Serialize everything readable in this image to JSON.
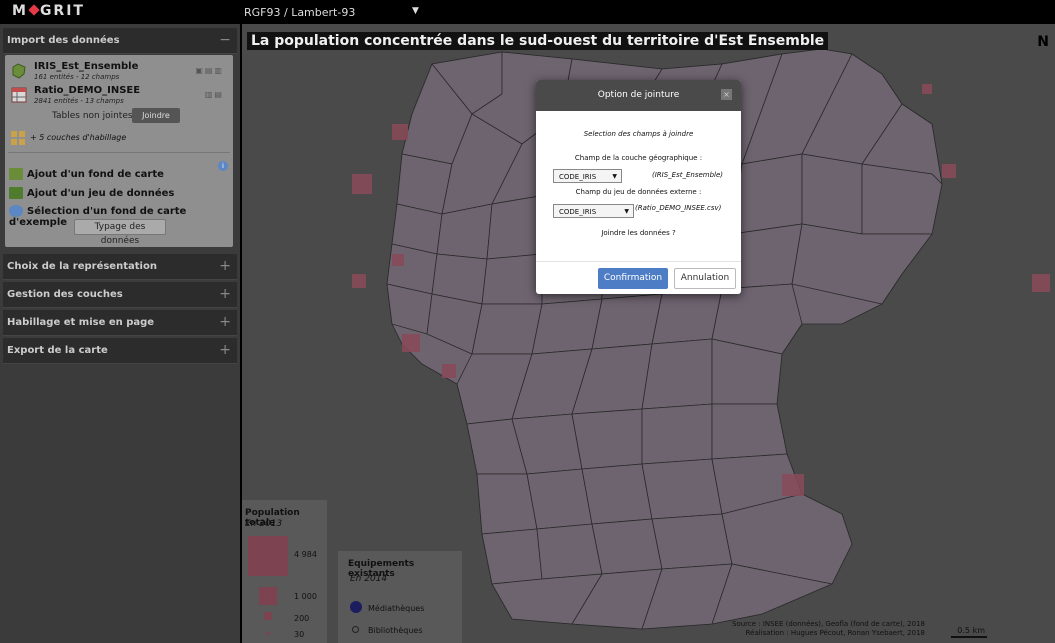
{
  "app": {
    "logo_text_left": "M",
    "logo_text_right": "GRIT",
    "projection": "RGF93 / Lambert-93"
  },
  "sidebar": {
    "import_panel": {
      "title": "Import des données",
      "toggle": "−",
      "layers": [
        {
          "name": "IRIS_Est_Ensemble",
          "sub": "161 entités - 12 champs",
          "icon": "polygon-layer-icon"
        },
        {
          "name": "Ratio_DEMO_INSEE",
          "sub": "2841 entités - 13 champs",
          "icon": "table-layer-icon"
        }
      ],
      "tables_label": "Tables non jointes",
      "join_button": "Joindre",
      "hab_layers": "+ 5 couches d'habillage",
      "actions": [
        "Ajout d'un fond de carte",
        "Ajout d'un jeu de données",
        "Sélection d'un fond de carte d'exemple"
      ],
      "info": "i",
      "typage_button": "Typage des données"
    },
    "panels": [
      {
        "title": "Choix de la représentation",
        "toggle": "+"
      },
      {
        "title": "Gestion des couches",
        "toggle": "+"
      },
      {
        "title": "Habillage et mise en page",
        "toggle": "+"
      },
      {
        "title": "Export de la carte",
        "toggle": "+"
      }
    ]
  },
  "map": {
    "title": "La population concentrée dans le sud-ouest du territoire d'Est Ensemble",
    "north": "N",
    "legend_population": {
      "title": "Population totale",
      "subtitle": "En 2013",
      "values": [
        "4 984",
        "1 000",
        "200",
        "30"
      ]
    },
    "legend_equipements": {
      "title": "Equipements existants",
      "subtitle": "En 2014",
      "items": [
        "Médiathèques",
        "Bibliothèques"
      ]
    },
    "source_line1": "Source : INSEE (données), Geofla (fond de carte), 2018",
    "source_line2": "Réalisation : Hugues Pécout, Ronan Ysebaert, 2018",
    "scale_label": "0.5 km"
  },
  "modal": {
    "title": "Option de jointure",
    "close": "×",
    "instruction": "Selection des champs à joindre",
    "geo_label": "Champ de la couche géographique :",
    "geo_select": "CODE_IRIS",
    "geo_dataset": "(IRIS_Est_Ensemble)",
    "ext_label": "Champ du jeu de données externe :",
    "ext_select": "CODE_IRIS",
    "ext_dataset": "(Ratio_DEMO_INSEE.csv)",
    "question": "Joindre les données ?",
    "confirm": "Confirmation",
    "cancel": "Annulation"
  },
  "colors": {
    "accent": "#4d7dc4",
    "polygon_fill": "#6e6470",
    "symbol_fill": "#7d4350"
  }
}
